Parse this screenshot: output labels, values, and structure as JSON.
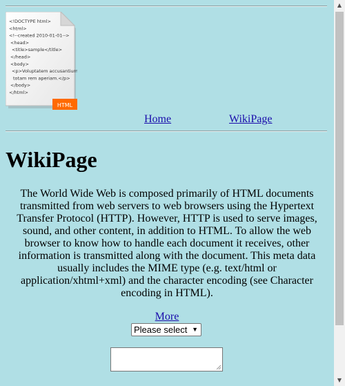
{
  "logo": {
    "code_lines": [
      "<!DOCTYPE html>",
      "<html>",
      "<!--created 2010-01-01-->",
      "<head>",
      "<title>sample</title>",
      "</head>",
      "<body>",
      "<p>Voluptatem accusantium",
      "totam rem aperiam.</p>",
      "</body>",
      "</html>"
    ],
    "badge": "HTML"
  },
  "nav": {
    "home": "Home",
    "wikipage": "WikiPage"
  },
  "page_title": "WikiPage",
  "body_text": "The World Wide Web is composed primarily of HTML documents transmitted from web servers to web browsers using the Hypertext Transfer Protocol (HTTP). However, HTTP is used to serve images, sound, and other content, in addition to HTML. To allow the web browser to know how to handle each document it receives, other information is transmitted along with the document. This meta data usually includes the MIME type (e.g. text/html or application/xhtml+xml) and the character encoding (see Character encoding in HTML).",
  "more_link": "More",
  "select": {
    "selected": "Please select"
  },
  "textarea": {
    "value": ""
  }
}
